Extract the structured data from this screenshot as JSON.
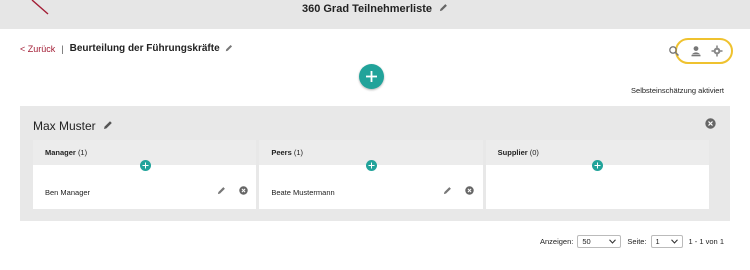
{
  "header": {
    "title": "360 Grad Teilnehmerliste"
  },
  "breadcrumb": {
    "back": "< Zurück",
    "separator": "|",
    "page_title": "Beurteilung der Führungskräfte"
  },
  "toolbar": {
    "icons": [
      "search-icon",
      "user-upload-icon",
      "settings-icon"
    ],
    "highlight_color": "#efc22f"
  },
  "self_assessment_note": "Selbsteinschätzung aktiviert",
  "participant": {
    "name": "Max Muster",
    "groups": [
      {
        "label": "Manager",
        "count": "(1)",
        "members": [
          "Ben Manager"
        ]
      },
      {
        "label": "Peers",
        "count": "(1)",
        "members": [
          "Beate Mustermann"
        ]
      },
      {
        "label": "Supplier",
        "count": "(0)",
        "members": []
      }
    ]
  },
  "pagination": {
    "show_label": "Anzeigen:",
    "page_size": "50",
    "page_label": "Seite:",
    "page": "1",
    "range": "1 - 1 von 1"
  },
  "colors": {
    "accent": "#21a39a",
    "link": "#a31d35",
    "card_bg": "#e8e8e8"
  }
}
